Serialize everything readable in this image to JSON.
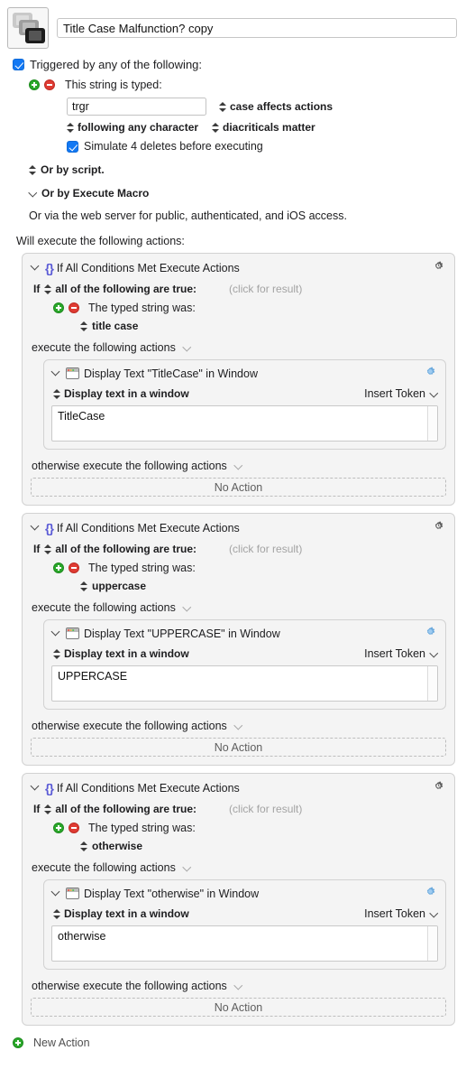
{
  "macro": {
    "icon_name": "cascading-windows-icon",
    "title_value": "Title Case Malfunction? copy",
    "title_placeholder": "Macro Name"
  },
  "trigger": {
    "enabled_label": "Triggered by any of the following:",
    "add_icon": "plus-circle-icon",
    "remove_icon": "minus-circle-icon",
    "type_label": "This string is typed:",
    "string_value": "trgr",
    "string_placeholder": "",
    "case_option": "case affects actions",
    "following_option": "following any character",
    "diacriticals_option": "diacriticals matter",
    "simulate_label": "Simulate 4 deletes before executing",
    "or_script": "Or by script.",
    "or_execute_macro": "Or by Execute Macro",
    "or_web": "Or via the web server for public, authenticated, and iOS access."
  },
  "actions_intro": "Will execute the following actions:",
  "common": {
    "if_word": "If",
    "condition_mode": "all of the following are true:",
    "click_for_result": "(click for result)",
    "condition_label": "The typed string was:",
    "execute_label": "execute the following actions",
    "otherwise_label": "otherwise execute the following actions",
    "no_action_label": "No Action",
    "display_mode": "Display text in a window",
    "insert_token": "Insert Token",
    "gear_icon": "gear-icon",
    "gear_blue_icon": "gear-icon-highlighted",
    "braces_icon": "curly-braces-icon",
    "window_icon": "window-icon",
    "disclosure_icon": "chevron-down-icon",
    "stepper_icon": "stepper-updown-icon"
  },
  "blocks": [
    {
      "title": "If All Conditions Met Execute Actions",
      "condition_value": "title case",
      "action_title": "Display Text \"TitleCase\" in Window",
      "text_value": "TitleCase"
    },
    {
      "title": "If All Conditions Met Execute Actions",
      "condition_value": "uppercase",
      "action_title": "Display Text \"UPPERCASE\" in Window",
      "text_value": "UPPERCASE"
    },
    {
      "title": "If All Conditions Met Execute Actions",
      "condition_value": "otherwise",
      "action_title": "Display Text \"otherwise\" in Window",
      "text_value": "otherwise"
    }
  ],
  "footer": {
    "new_action_label": "New Action",
    "new_action_icon": "plus-circle-icon"
  },
  "colors": {
    "accent_blue": "#1278f3",
    "braces_purple": "#5b5bd6",
    "plus_green": "#2aa82a",
    "minus_red": "#df3b33",
    "gear_blue": "#8fc4f0"
  }
}
